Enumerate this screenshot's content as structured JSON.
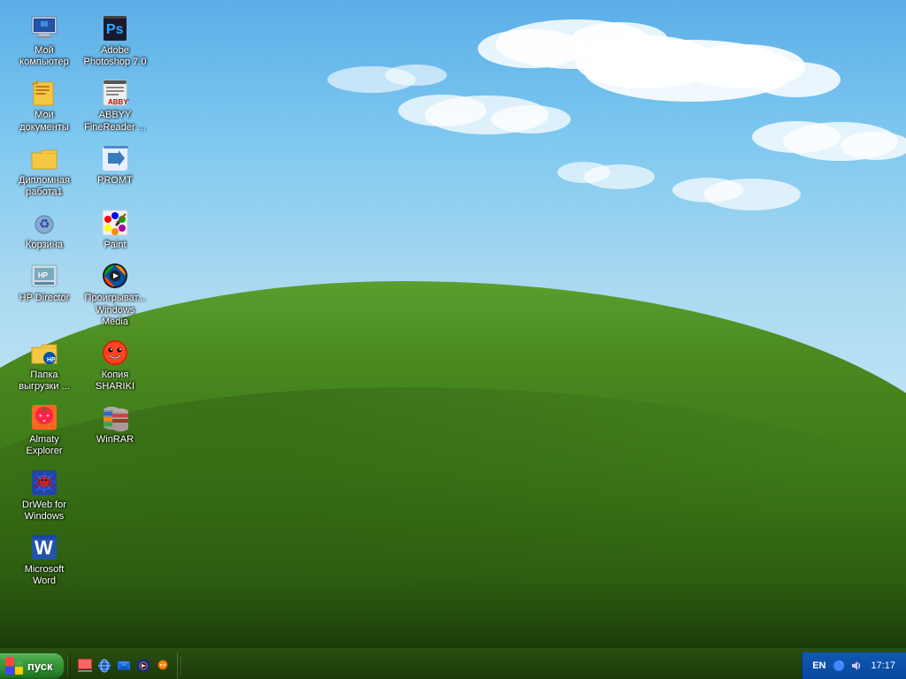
{
  "desktop": {
    "background_sky_color": "#5baee8",
    "background_grass_color": "#5a9e2f"
  },
  "icons": [
    {
      "row": 0,
      "col": 0,
      "id": "my-computer",
      "label": "Мой\nкомпьютер",
      "icon_type": "computer"
    },
    {
      "row": 0,
      "col": 1,
      "id": "adobe-photoshop",
      "label": "Adobe\nPhotoshop 7.0",
      "icon_type": "photoshop"
    },
    {
      "row": 1,
      "col": 0,
      "id": "my-documents",
      "label": "Мои\nдокументы",
      "icon_type": "documents"
    },
    {
      "row": 1,
      "col": 1,
      "id": "abbyy-finereader",
      "label": "ABBYY\nFineReader ...",
      "icon_type": "abbyy"
    },
    {
      "row": 2,
      "col": 0,
      "id": "diploma-work",
      "label": "Дипломная\nработа1",
      "icon_type": "folder"
    },
    {
      "row": 2,
      "col": 1,
      "id": "promt",
      "label": "PROMT",
      "icon_type": "promt"
    },
    {
      "row": 3,
      "col": 0,
      "id": "recycle-bin",
      "label": "Корзина",
      "icon_type": "recycle"
    },
    {
      "row": 3,
      "col": 1,
      "id": "paint",
      "label": "Paint",
      "icon_type": "paint"
    },
    {
      "row": 4,
      "col": 0,
      "id": "hp-director",
      "label": "HP Director",
      "icon_type": "hp-director"
    },
    {
      "row": 4,
      "col": 1,
      "id": "windows-media",
      "label": "Проигрыват...\nWindows Media",
      "icon_type": "wmp"
    },
    {
      "row": 5,
      "col": 0,
      "id": "download-folder",
      "label": "Папка\nвыгрузки ...",
      "icon_type": "hp-folder"
    },
    {
      "row": 5,
      "col": 1,
      "id": "shariki",
      "label": "Копия\nSHARIKI",
      "icon_type": "shariki"
    },
    {
      "row": 6,
      "col": 0,
      "id": "almaty-explorer",
      "label": "Almaty\nExplorer",
      "icon_type": "almaty"
    },
    {
      "row": 6,
      "col": 1,
      "id": "winrar",
      "label": "WinRAR",
      "icon_type": "winrar"
    },
    {
      "row": 7,
      "col": 0,
      "id": "drweb",
      "label": "DrWeb for\nWindows",
      "icon_type": "drweb"
    },
    {
      "row": 8,
      "col": 0,
      "id": "ms-word",
      "label": "Microsoft Word",
      "icon_type": "word"
    }
  ],
  "taskbar": {
    "start_label": "пуск",
    "quick_launch": [
      {
        "id": "show-desktop",
        "tooltip": "Show Desktop"
      },
      {
        "id": "ie",
        "tooltip": "Internet Explorer"
      },
      {
        "id": "outlook",
        "tooltip": "Outlook Express"
      },
      {
        "id": "media-player",
        "tooltip": "Windows Media Player"
      },
      {
        "id": "messenger",
        "tooltip": "Windows Messenger"
      }
    ],
    "tray": {
      "lang": "EN",
      "clock": "17:17"
    }
  }
}
